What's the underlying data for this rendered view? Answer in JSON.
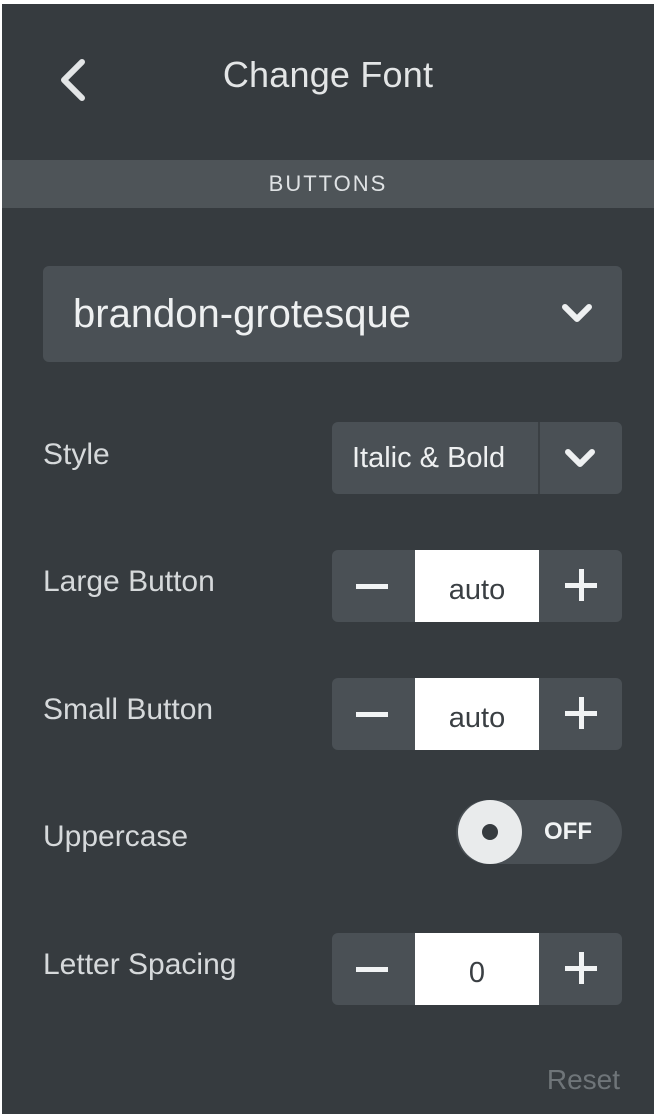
{
  "header": {
    "title": "Change Font",
    "back_icon": "chevron-left-icon"
  },
  "section": {
    "label": "BUTTONS"
  },
  "font_family": {
    "value": "brandon-grotesque",
    "icon": "chevron-down-icon"
  },
  "style": {
    "label": "Style",
    "value": "Italic & Bold",
    "icon": "chevron-down-icon"
  },
  "large_button": {
    "label": "Large Button",
    "value": "auto"
  },
  "small_button": {
    "label": "Small Button",
    "value": "auto"
  },
  "uppercase": {
    "label": "Uppercase",
    "state": "OFF"
  },
  "letter_spacing": {
    "label": "Letter Spacing",
    "value": "0"
  },
  "reset_label": "Reset",
  "colors": {
    "panel_bg": "#363b3f",
    "control_bg": "#4a5055",
    "section_bar": "#4e5458",
    "text": "#e3e5e6",
    "muted": "#6f7579"
  }
}
